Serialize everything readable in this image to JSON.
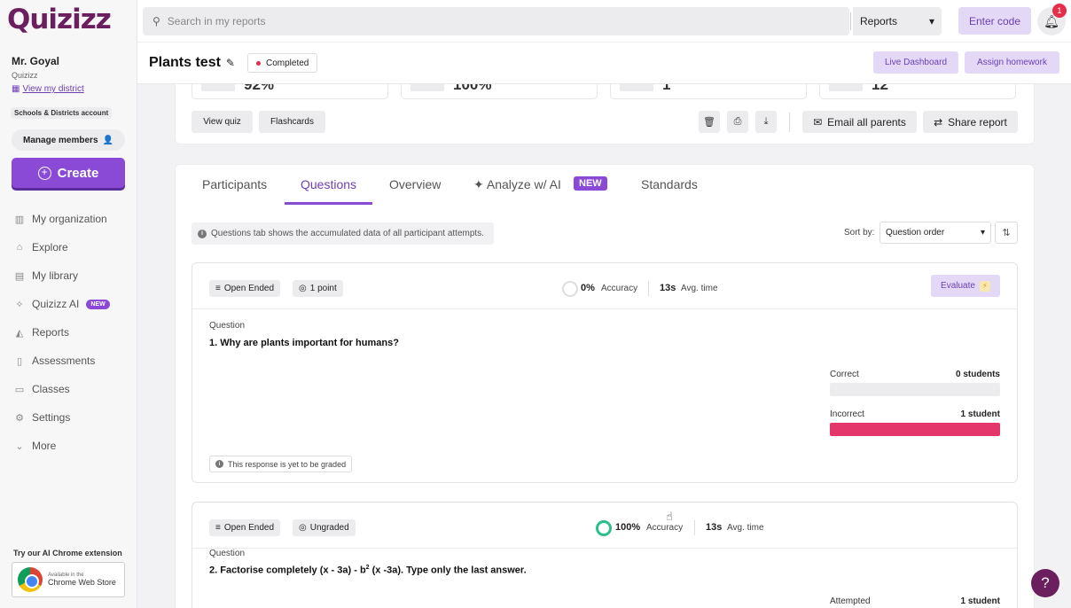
{
  "brand": {
    "logo": "Quizizz"
  },
  "user": {
    "name": "Mr. Goyal",
    "org": "Quizizz",
    "district_link": "View my district",
    "account_type": "Schools & Districts account"
  },
  "sidebar": {
    "manage_members": "Manage members",
    "create": "Create",
    "nav": [
      {
        "label": "My organization",
        "icon": "organization-icon"
      },
      {
        "label": "Explore",
        "icon": "explore-icon"
      },
      {
        "label": "My library",
        "icon": "library-icon"
      },
      {
        "label": "Quizizz AI",
        "icon": "ai-sparkle-icon",
        "badge": "NEW"
      },
      {
        "label": "Reports",
        "icon": "reports-icon"
      },
      {
        "label": "Assessments",
        "icon": "assessments-icon"
      },
      {
        "label": "Classes",
        "icon": "classes-icon"
      },
      {
        "label": "Settings",
        "icon": "gear-icon"
      },
      {
        "label": "More",
        "icon": "chevron-down-icon"
      }
    ],
    "extension_title": "Try our AI Chrome extension",
    "extension_store_line1": "Available in the",
    "extension_store_line2": "Chrome Web Store"
  },
  "topbar": {
    "search_placeholder": "Search in my reports",
    "search_scope": "Reports",
    "enter_code": "Enter code",
    "notifications": "1"
  },
  "report": {
    "title": "Plants test",
    "status": "Completed",
    "live_dashboard": "Live Dashboard",
    "assign_homework": "Assign homework"
  },
  "summary": {
    "stats": [
      "92%",
      "100%",
      "1",
      "12"
    ],
    "view_quiz": "View quiz",
    "flashcards": "Flashcards",
    "email_parents": "Email all parents",
    "share_report": "Share report"
  },
  "tabs": [
    {
      "label": "Participants",
      "active": false
    },
    {
      "label": "Questions",
      "active": true
    },
    {
      "label": "Overview",
      "active": false
    },
    {
      "label": "Analyze w/ AI",
      "active": false,
      "badge": "NEW"
    },
    {
      "label": "Standards",
      "active": false
    }
  ],
  "questions_info": "Questions tab shows the accumulated data of all participant attempts.",
  "sort": {
    "label": "Sort by:",
    "value": "Question order"
  },
  "questions": [
    {
      "type": "Open Ended",
      "points": "1 point",
      "accuracy": "0%",
      "accuracy_label": "Accuracy",
      "time": "13s",
      "time_label": "Avg. time",
      "evaluate": "Evaluate",
      "question_label": "Question",
      "text": "1. Why are plants important for humans?",
      "correct_label": "Correct",
      "correct_value": "0 students",
      "correct_fraction": 0,
      "incorrect_label": "Incorrect",
      "incorrect_value": "1 student",
      "incorrect_fraction": 1,
      "graded_note": "This response is yet to be graded"
    },
    {
      "type": "Open Ended",
      "points": "Ungraded",
      "accuracy": "100%",
      "accuracy_label": "Accuracy",
      "time": "13s",
      "time_label": "Avg. time",
      "question_label": "Question",
      "text_parts": [
        "2. Factorise completely (x - 3a) - b",
        "2",
        " (x -3a). Type only the last answer."
      ],
      "attempted_label": "Attempted",
      "attempted_value": "1 student"
    }
  ],
  "help": "?",
  "colors": {
    "brand_purple": "#8a4ad6",
    "accent_dark": "#6b1f5e",
    "incorrect_bar": "#e4366a",
    "accuracy_full": "#2bbf8a"
  }
}
